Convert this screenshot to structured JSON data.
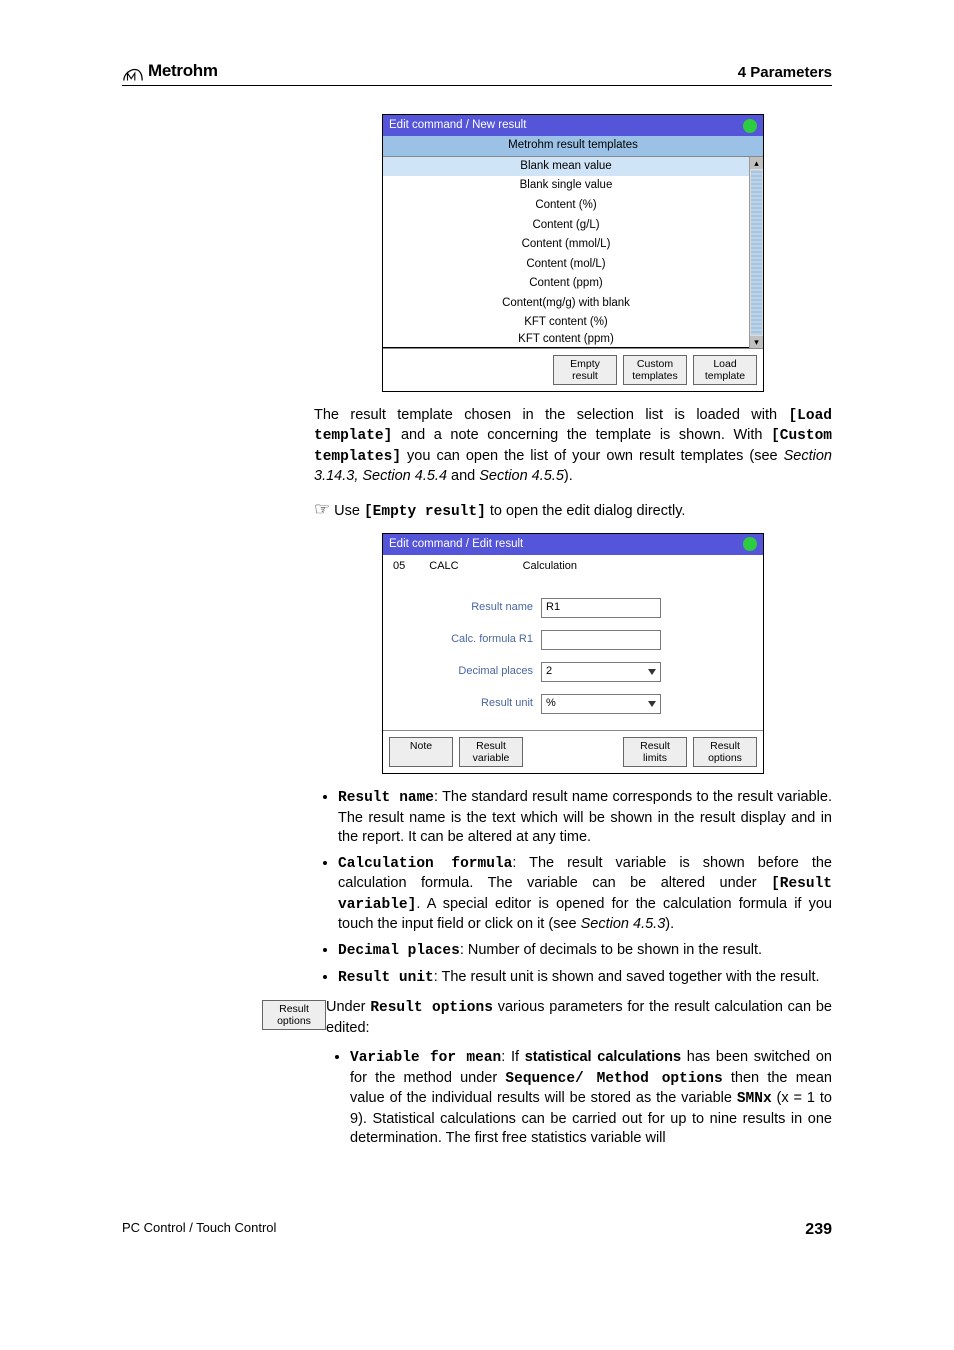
{
  "header": {
    "brand": "Metrohm",
    "chapter": "4 Parameters"
  },
  "panel1": {
    "title": "Edit command / New result",
    "subhead": "Metrohm result templates",
    "items": [
      "Blank mean value",
      "Blank single value",
      "Content (%)",
      "Content (g/L)",
      "Content (mmol/L)",
      "Content (mol/L)",
      "Content (ppm)",
      "Content(mg/g) with blank",
      "KFT content (%)",
      "KFT content (ppm)"
    ],
    "buttons": {
      "empty": "Empty\nresult",
      "custom": "Custom\ntemplates",
      "load": "Load\ntemplate"
    }
  },
  "para1": {
    "a": "The result template chosen in the selection list is loaded with ",
    "b": "[Load template]",
    "c": " and a note concerning the template is shown. With ",
    "d": "[Custom templates]",
    "e": " you can open the list of your own result templates (see ",
    "f": "Section 3.14.3, Section 4.5.4",
    "g": " and ",
    "h": "Section 4.5.5",
    "i": ")."
  },
  "hint": {
    "a": "Use ",
    "b": "[Empty result]",
    "c": " to open the edit dialog directly."
  },
  "panel2": {
    "title": "Edit command / Edit result",
    "line": {
      "num": "05",
      "code": "CALC",
      "type": "Calculation"
    },
    "labels": {
      "rname": "Result name",
      "formula": "Calc. formula R1",
      "dec": "Decimal places",
      "unit": "Result unit"
    },
    "values": {
      "rname": "R1",
      "dec": "2",
      "unit": "%"
    },
    "buttons": {
      "note": "Note",
      "rvar": "Result\nvariable",
      "rlim": "Result\nlimits",
      "ropt": "Result\noptions"
    }
  },
  "bullets1": {
    "b1": {
      "t": "Result name",
      "x": ": The standard result name corresponds to the result variable. The result name is the text which will be shown in the result display and in the report. It can be altered at any time."
    },
    "b2": {
      "t": "Calculation formula",
      "x1": ": The result variable is shown before the calculation formula. The variable can be altered under ",
      "x2": "[Result variable]",
      "x3": ". A special editor is opened for the calculation formula if you touch the input field or click on it (see ",
      "x4": "Section 4.5.3",
      "x5": ")."
    },
    "b3": {
      "t": "Decimal places",
      "x": ": Number of decimals to be shown in the result."
    },
    "b4": {
      "t": "Result unit",
      "x": ": The result unit is shown and saved together with the result."
    }
  },
  "marginbtn": "Result\noptions",
  "para2": {
    "a": "Under ",
    "b": "Result options",
    "c": " various parameters for the result calculation can be edited:"
  },
  "bullets2": {
    "b1": {
      "t": "Variable for mean",
      "x1": ": If ",
      "x2": "statistical calculations",
      "x3": " has been switched on for the method under ",
      "x4": "Sequence/ Method options",
      "x5": " then the mean value of the individual results will be stored as the variable ",
      "x6": "SMNx",
      "x7": " (x = 1 to 9). Statistical calculations can be carried out for up to nine results in one determination. The first free statistics variable will"
    }
  },
  "footer": {
    "left": "PC Control / Touch Control",
    "page": "239"
  }
}
